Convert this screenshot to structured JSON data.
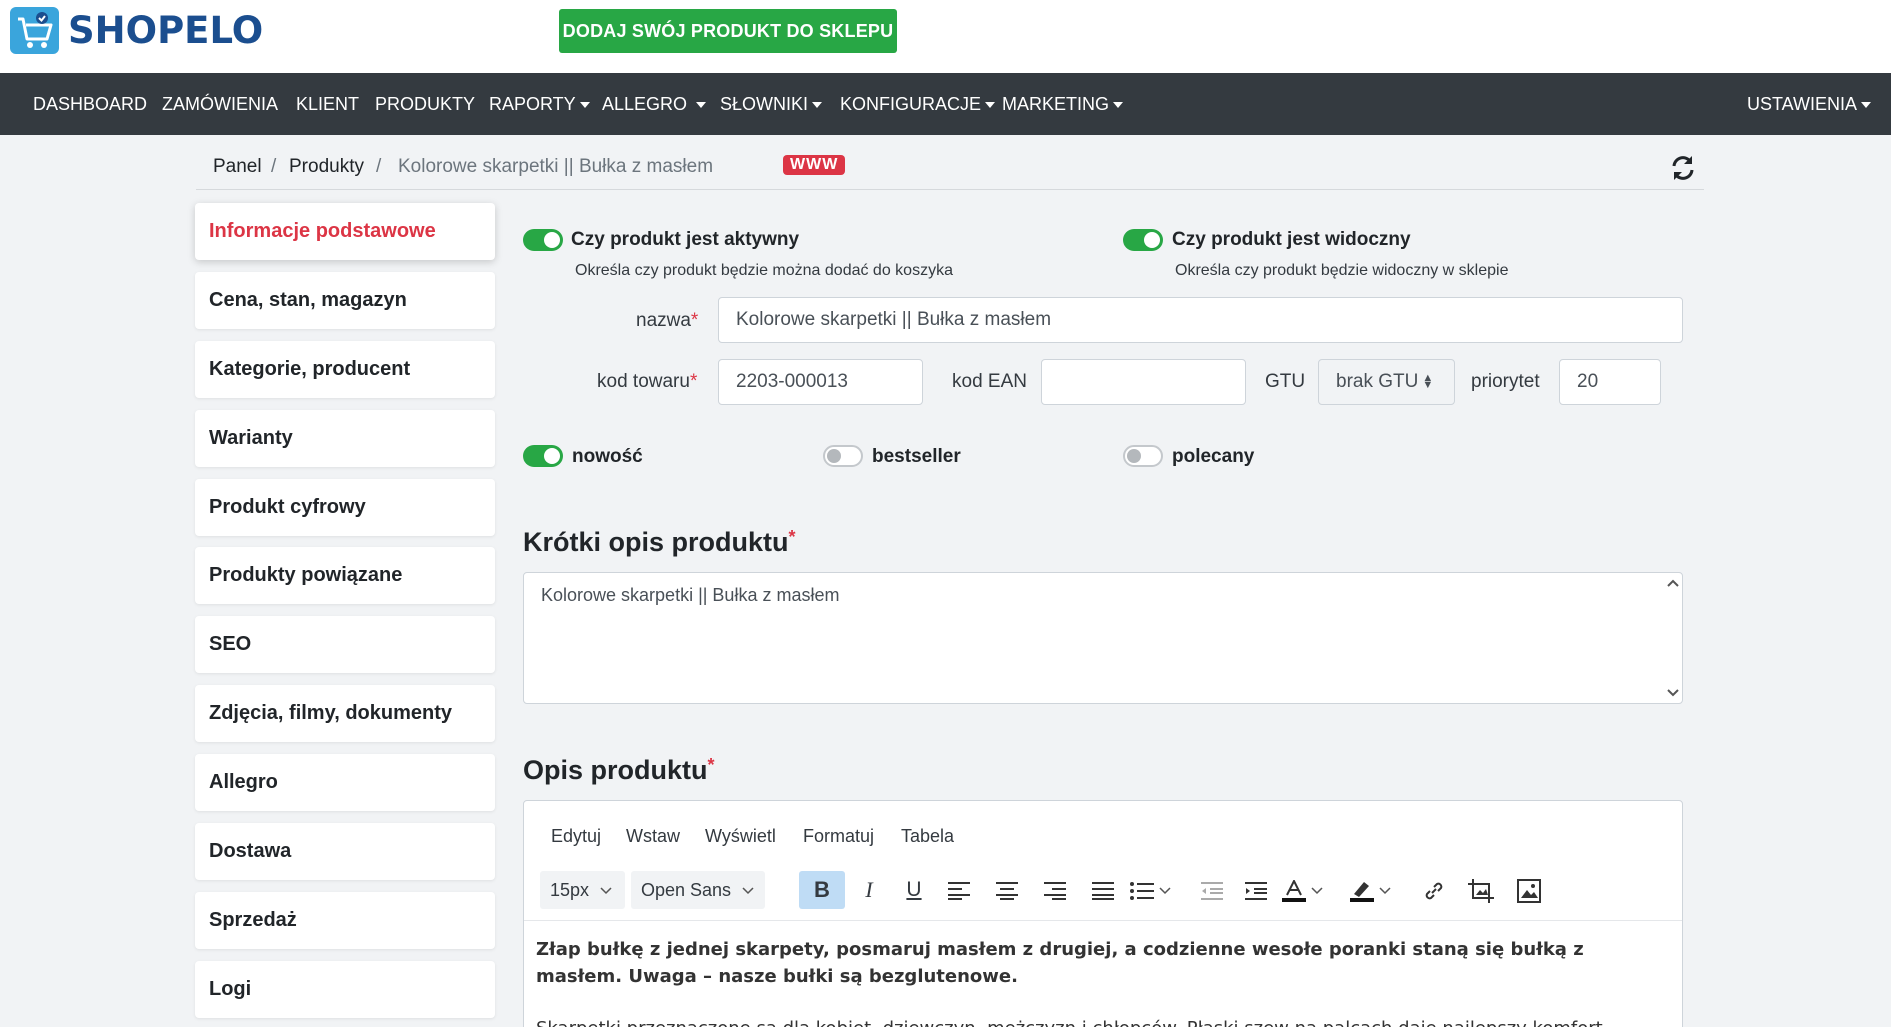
{
  "brand": {
    "name": "SHOPELO",
    "logo_color": "#3aa5dc",
    "text_color": "#1b4e8f"
  },
  "cta": {
    "label": "DODAJ SWÓJ PRODUKT DO SKLEPU",
    "color": "#28a745"
  },
  "nav": {
    "items": [
      {
        "label": "DASHBOARD",
        "dropdown": false
      },
      {
        "label": "ZAMÓWIENIA",
        "dropdown": false
      },
      {
        "label": "KLIENT",
        "dropdown": false
      },
      {
        "label": "PRODUKTY",
        "dropdown": false
      },
      {
        "label": "RAPORTY",
        "dropdown": true
      },
      {
        "label": "ALLEGRO",
        "dropdown": true
      },
      {
        "label": "SŁOWNIKI",
        "dropdown": true
      },
      {
        "label": "KONFIGURACJE",
        "dropdown": true
      },
      {
        "label": "MARKETING",
        "dropdown": true
      }
    ],
    "right": {
      "label": "USTAWIENIA",
      "dropdown": true
    }
  },
  "breadcrumb": {
    "items": [
      "Panel",
      "Produkty",
      "Kolorowe skarpetki || Bułka z masłem"
    ],
    "separator": "/",
    "badge": "WWW"
  },
  "sidebar": {
    "items": [
      {
        "label": "Informacje podstawowe",
        "active": true
      },
      {
        "label": "Cena, stan, magazyn"
      },
      {
        "label": "Kategorie, producent"
      },
      {
        "label": "Warianty"
      },
      {
        "label": "Produkt cyfrowy"
      },
      {
        "label": "Produkty powiązane"
      },
      {
        "label": "SEO"
      },
      {
        "label": "Zdjęcia, filmy, dokumenty"
      },
      {
        "label": "Allegro"
      },
      {
        "label": "Dostawa"
      },
      {
        "label": "Sprzedaż"
      },
      {
        "label": "Logi"
      }
    ]
  },
  "toggles": {
    "active": {
      "label": "Czy produkt jest aktywny",
      "help": "Określa czy produkt będzie można dodać do koszyka",
      "on": true
    },
    "visible": {
      "label": "Czy produkt jest widoczny",
      "help": "Określa czy produkt będzie widoczny w sklepie",
      "on": true
    },
    "new": {
      "label": "nowość",
      "on": true
    },
    "bestseller": {
      "label": "bestseller",
      "on": false
    },
    "recommended": {
      "label": "polecany",
      "on": false
    }
  },
  "form": {
    "name": {
      "label": "nazwa",
      "required": "*",
      "value": "Kolorowe skarpetki || Bułka z masłem"
    },
    "code": {
      "label": "kod towaru",
      "required": "*",
      "value": "2203-000013"
    },
    "ean": {
      "label": "kod EAN",
      "value": ""
    },
    "gtu": {
      "label": "GTU",
      "value": "brak GTU"
    },
    "priority": {
      "label": "priorytet",
      "value": "20"
    }
  },
  "short_desc": {
    "title": "Krótki opis produktu",
    "required": "*",
    "value": "Kolorowe skarpetki || Bułka z masłem"
  },
  "description": {
    "title": "Opis produktu",
    "required": "*",
    "menu": [
      "Edytuj",
      "Wstaw",
      "Wyświetl",
      "Formatuj",
      "Tabela"
    ],
    "font_size": "15px",
    "font_family": "Open Sans",
    "bold_text": "Złap bułkę z jednej skarpety, posmaruj masłem z drugiej, a codzienne wesołe poranki staną się bułką z masłem. Uwaga – nasze bułki są bezglutenowe.",
    "body_text": "Skarpetki przeznaczone są dla kobiet, dziewczyn, mężczyzn i chłopców. Płaski szew na palcach daje najlepszy komfort"
  },
  "colors": {
    "nav_bg": "#343a40",
    "accent_red": "#dc3545",
    "switch_on": "#28a745"
  }
}
